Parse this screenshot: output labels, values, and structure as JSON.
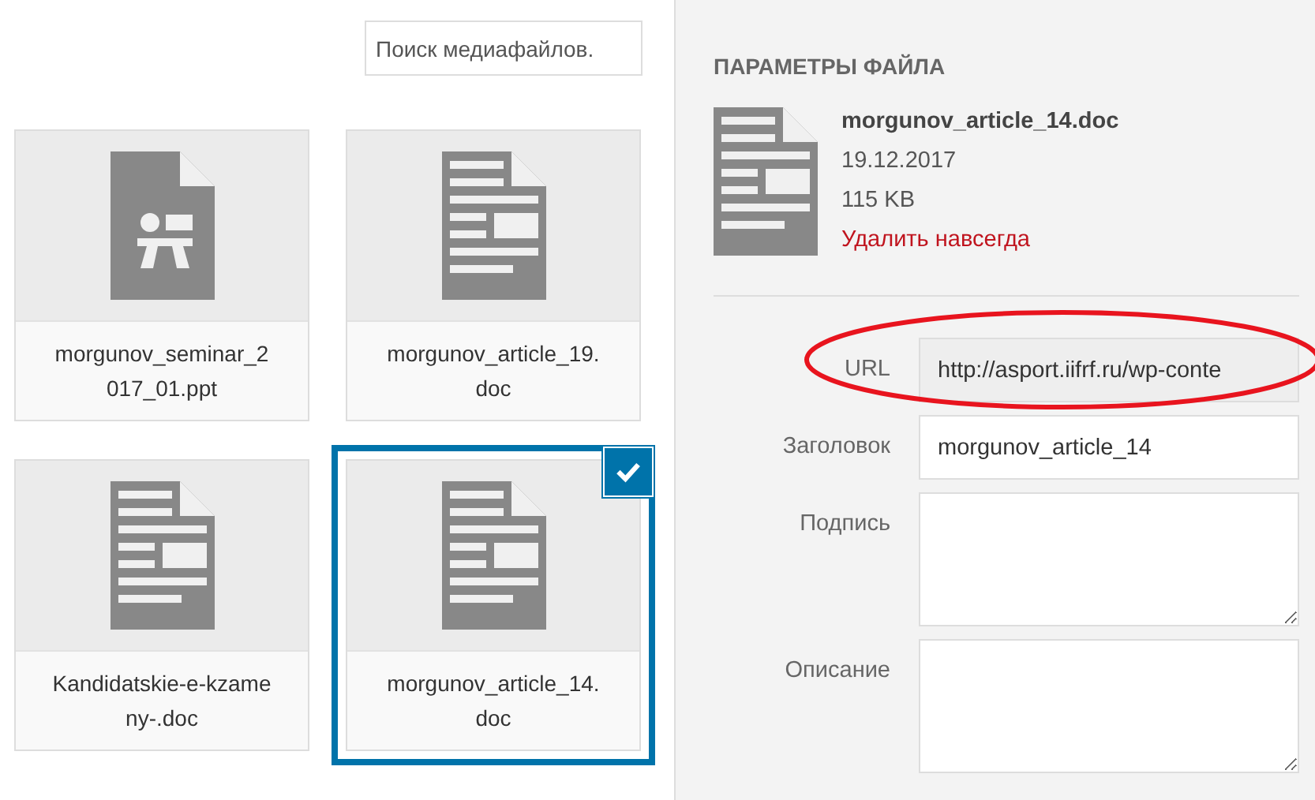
{
  "search": {
    "placeholder": "Поиск медиафайлов."
  },
  "files": [
    {
      "name": "morgunov_seminar_2017_01.ppt",
      "kind": "presentation",
      "selected": false
    },
    {
      "name": "morgunov_article_19.doc",
      "kind": "document",
      "selected": false
    },
    {
      "name": "Kandidatskie-e-kzameny-.doc",
      "kind": "document",
      "selected": false
    },
    {
      "name": "morgunov_article_14.doc",
      "kind": "document",
      "selected": true
    }
  ],
  "details": {
    "heading": "ПАРАМЕТРЫ ФАЙЛА",
    "file_name": "morgunov_article_14.doc",
    "date": "19.12.2017",
    "size": "115 KB",
    "delete_link": "Удалить навсегда",
    "fields": [
      {
        "label": "URL",
        "kind": "readonly",
        "value": "http://asport.iifrf.ru/wp-conte",
        "circled": true
      },
      {
        "label": "Заголовок",
        "kind": "input",
        "value": "morgunov_article_14"
      },
      {
        "label": "Подпись",
        "kind": "textarea"
      },
      {
        "label": "Описание",
        "kind": "textarea"
      }
    ]
  }
}
